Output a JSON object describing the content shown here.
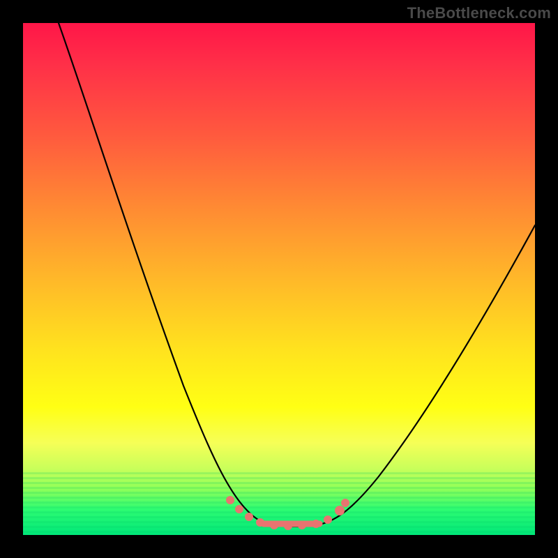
{
  "watermark": "TheBottleneck.com",
  "colors": {
    "frame": "#000000",
    "gradient_top": "#ff1648",
    "gradient_mid": "#ffe31e",
    "gradient_bottom": "#00e779",
    "curve": "#000000",
    "marker": "#e87470"
  },
  "chart_data": {
    "type": "line",
    "title": "",
    "xlabel": "",
    "ylabel": "",
    "xlim": [
      0,
      100
    ],
    "ylim": [
      0,
      100
    ],
    "x": [
      7,
      10,
      15,
      20,
      25,
      30,
      35,
      38,
      40,
      42,
      44,
      46,
      48,
      50,
      52,
      54,
      56,
      58,
      60,
      65,
      70,
      75,
      80,
      85,
      90,
      95,
      100
    ],
    "values": [
      100,
      90,
      75,
      61,
      48,
      36,
      25,
      18,
      13,
      9,
      6,
      4,
      2.5,
      2,
      2,
      2,
      2,
      2.5,
      3,
      6,
      11,
      18,
      26,
      35,
      44,
      53,
      61
    ],
    "flat_region_x": [
      48,
      58
    ],
    "markers_x": [
      40,
      42.5,
      45,
      47,
      49,
      51,
      53,
      55,
      57,
      59,
      61
    ],
    "notes": "V-shaped bottleneck curve; pink markers and thick segment highlight the near-zero bottleneck region at the trough."
  }
}
